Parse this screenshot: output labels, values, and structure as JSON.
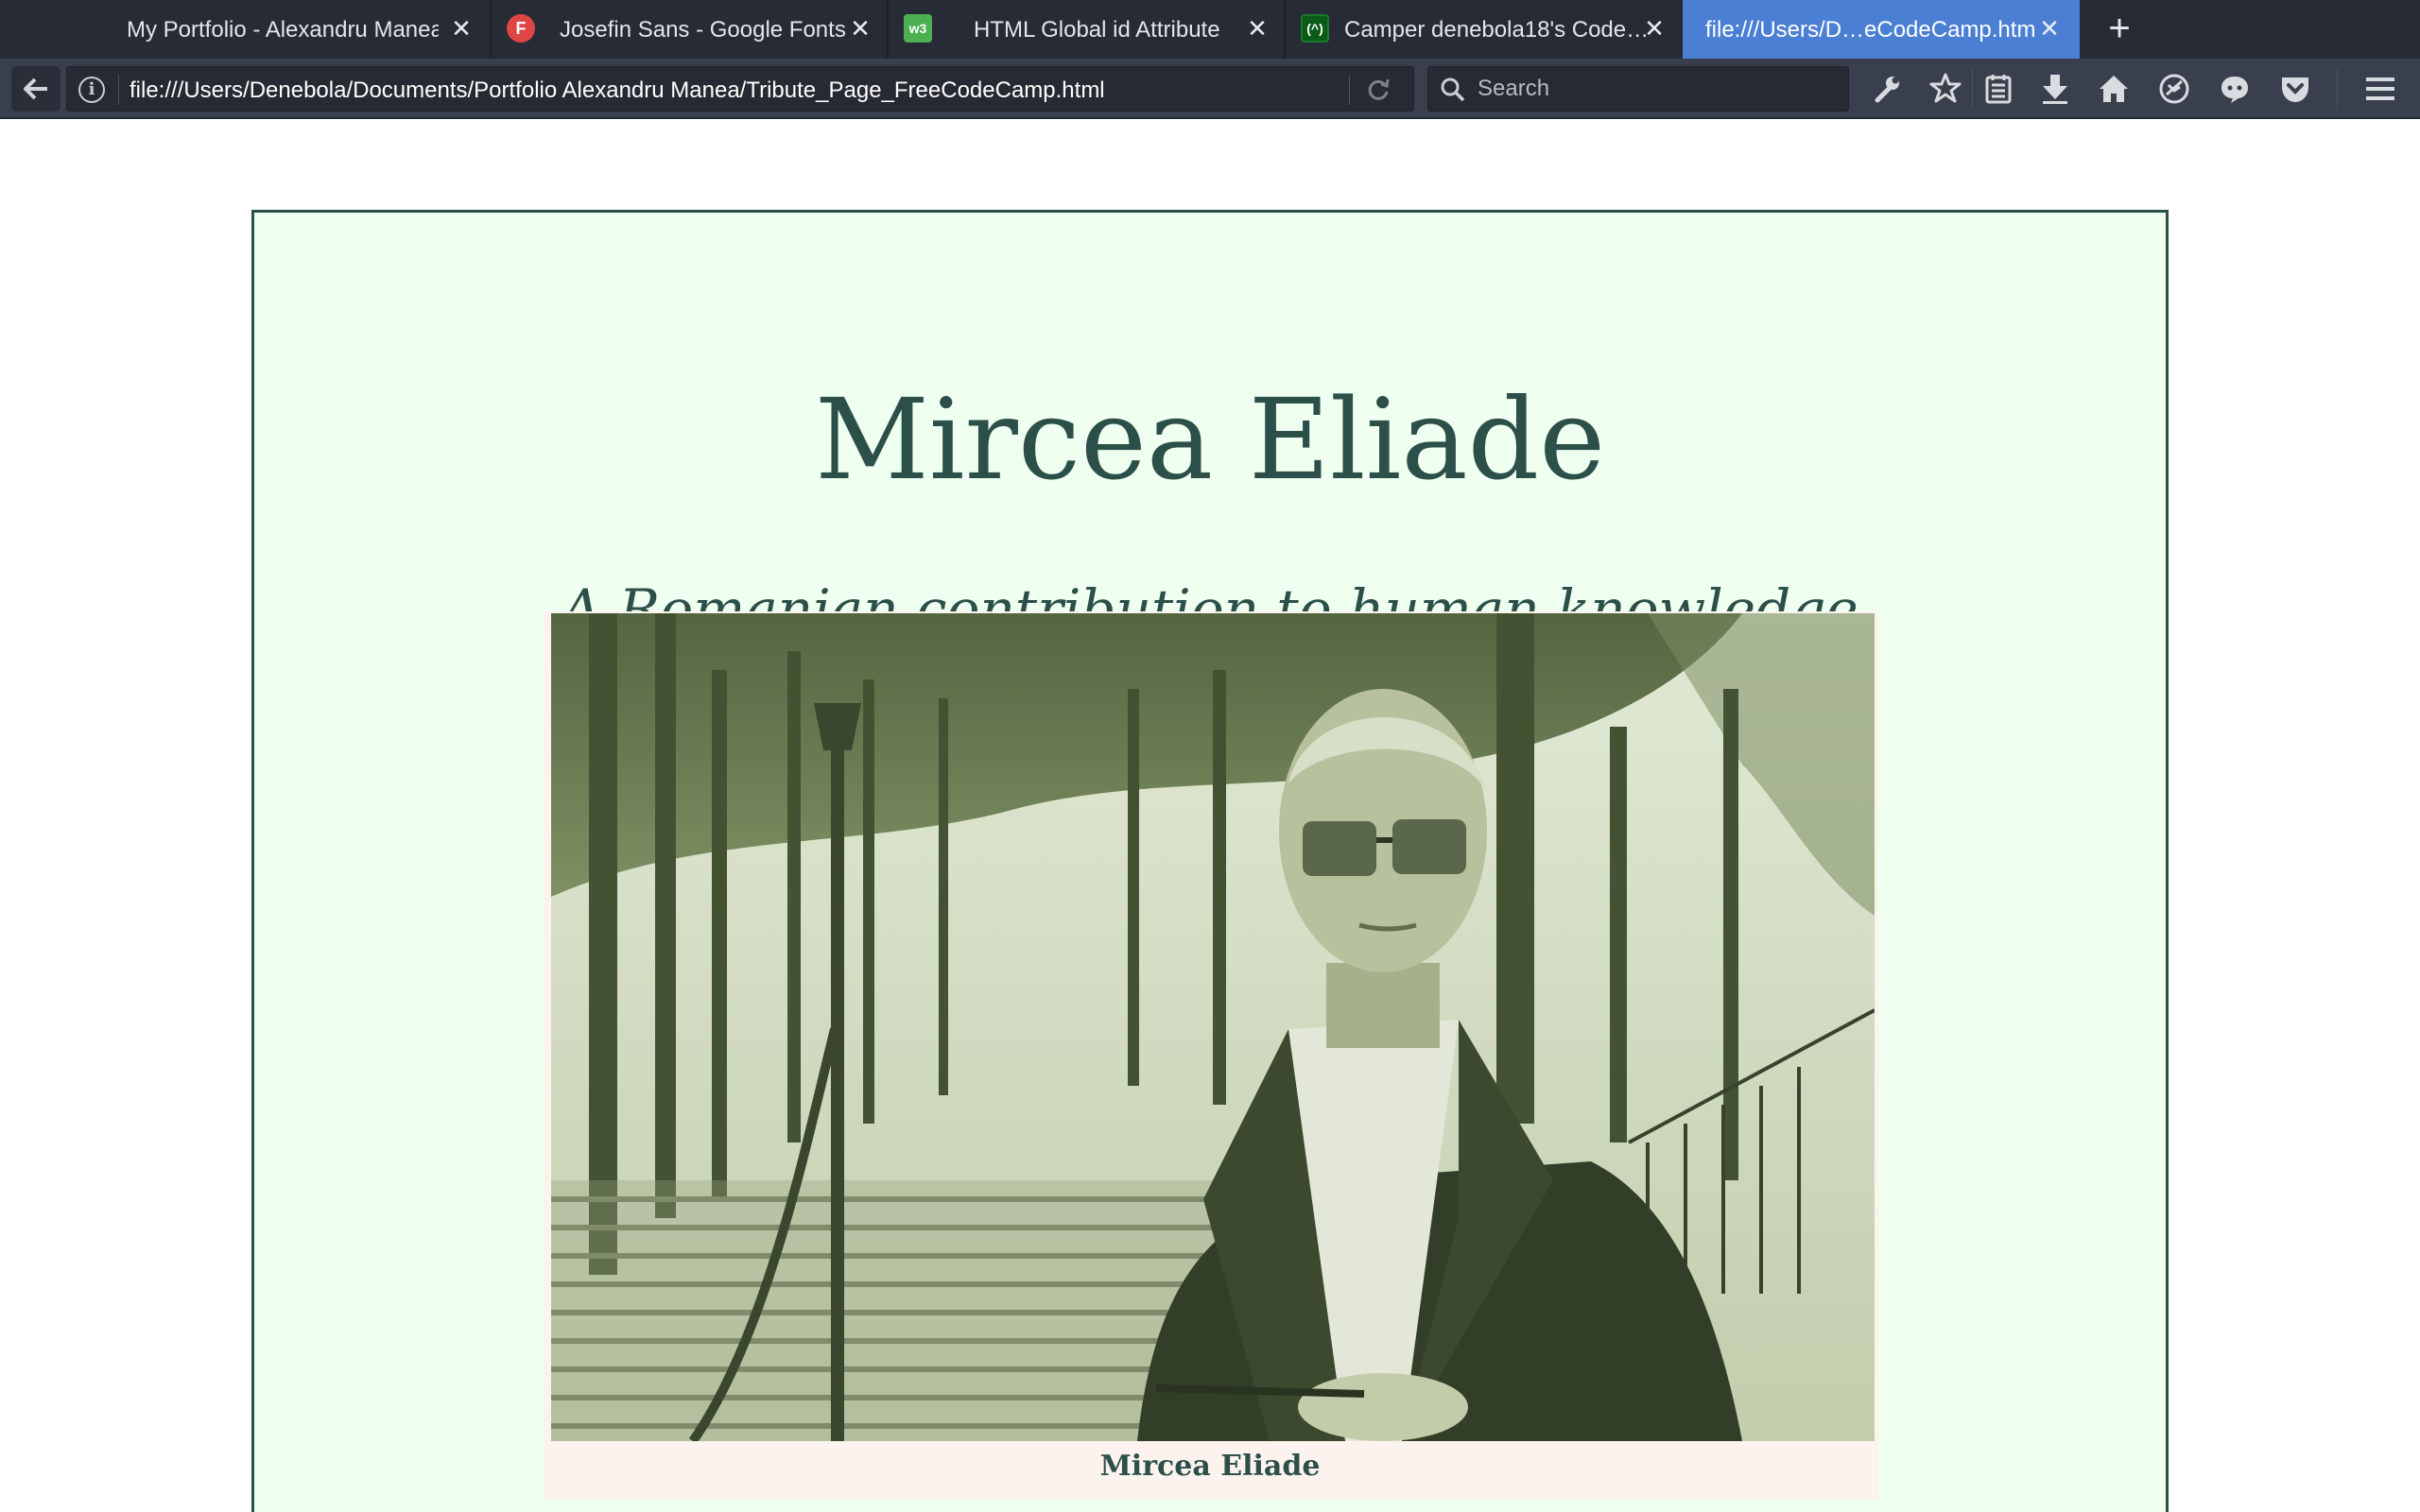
{
  "tabs": [
    {
      "title": "My Portfolio - Alexandru Manea",
      "active": false
    },
    {
      "title": "Josefin Sans - Google Fonts",
      "favicon_text": "F",
      "active": false
    },
    {
      "title": "HTML Global id Attribute",
      "favicon_text": "w3",
      "active": false
    },
    {
      "title": "Camper denebola18's Code…",
      "favicon_text": "(^)",
      "active": false
    },
    {
      "title": "file:///Users/D…eCodeCamp.html",
      "active": true
    }
  ],
  "tab_close_glyph": "✕",
  "new_tab_glyph": "+",
  "navbar": {
    "url": "file:///Users/Denebola/Documents/Portfolio Alexandru Manea/Tribute_Page_FreeCodeCamp.html",
    "search_placeholder": "Search"
  },
  "colors": {
    "tabstrip_bg": "#272b35",
    "active_tab_bg": "#4a7fd4",
    "navbar_bg": "#393f4c",
    "card_bg": "#effff0",
    "accent_text": "#2c4f4a",
    "figure_bg": "#fdf3ee"
  },
  "page": {
    "title": "Mircea Eliade",
    "subtitle": "A Romanian contribution to human knowledge",
    "image_caption": "Mircea Eliade"
  }
}
